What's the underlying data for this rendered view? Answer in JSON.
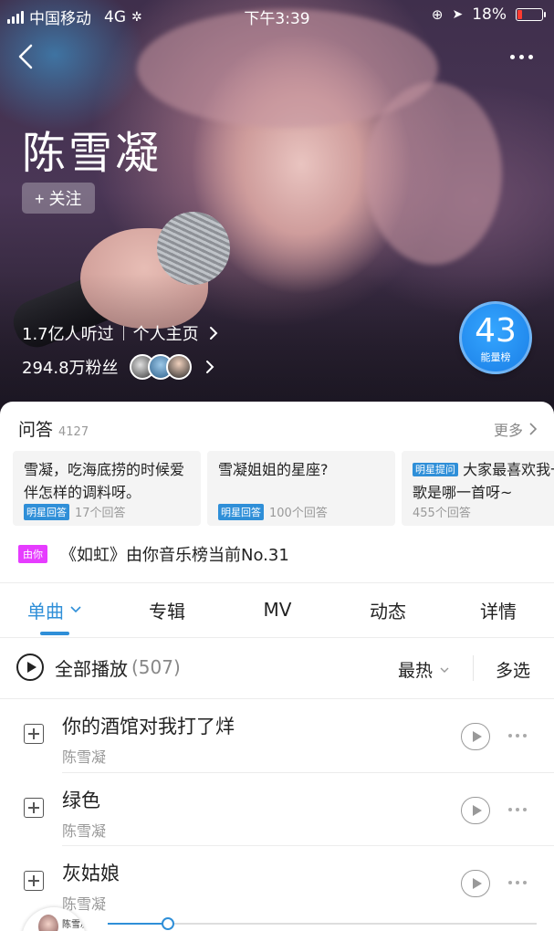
{
  "status_bar": {
    "carrier": "中国移动",
    "network": "4G",
    "time": "下午3:39",
    "battery_percent": "18%",
    "battery_level": 0.18,
    "battery_color": "#ff3b30"
  },
  "artist": {
    "name": "陈雪凝",
    "follow_label": "+ 关注",
    "listens": "1.7亿人听过",
    "homepage_link": "个人主页",
    "fans": "294.8万粉丝",
    "rank_number": "43",
    "rank_label": "能量榜"
  },
  "qa": {
    "title": "问答",
    "count": "4127",
    "more_label": "更多",
    "cards": [
      {
        "question": "雪凝，吃海底捞的时候爱伴怎样的调料呀。",
        "tag": "明星回答",
        "answers": "17个回答"
      },
      {
        "question": "雪凝姐姐的星座?",
        "tag": "明星回答",
        "answers": "100个回答"
      },
      {
        "tag": "明星提问",
        "question": "大家最喜欢我一首歌是哪一首呀~",
        "answers": "455个回答"
      }
    ]
  },
  "promo": {
    "badge": "由你",
    "text": "《如虹》由你音乐榜当前No.31"
  },
  "tabs": [
    {
      "label": "单曲"
    },
    {
      "label": "专辑"
    },
    {
      "label": "MV"
    },
    {
      "label": "动态"
    },
    {
      "label": "详情"
    }
  ],
  "playlist_header": {
    "play_all_label": "全部播放",
    "count": "(507)",
    "sort_label": "最热",
    "multi_select_label": "多选"
  },
  "songs": [
    {
      "title": "你的酒馆对我打了烊",
      "artist": "陈雪凝"
    },
    {
      "title": "绿色",
      "artist": "陈雪凝"
    },
    {
      "title": "灰姑娘",
      "artist": "陈雪凝"
    }
  ],
  "player": {
    "mini_text": "陈雪凝",
    "progress": 0.14
  },
  "colors": {
    "accent": "#2f8fd8",
    "promo_badge": "#e63cff",
    "rank_badge": "#1a7ee6"
  }
}
